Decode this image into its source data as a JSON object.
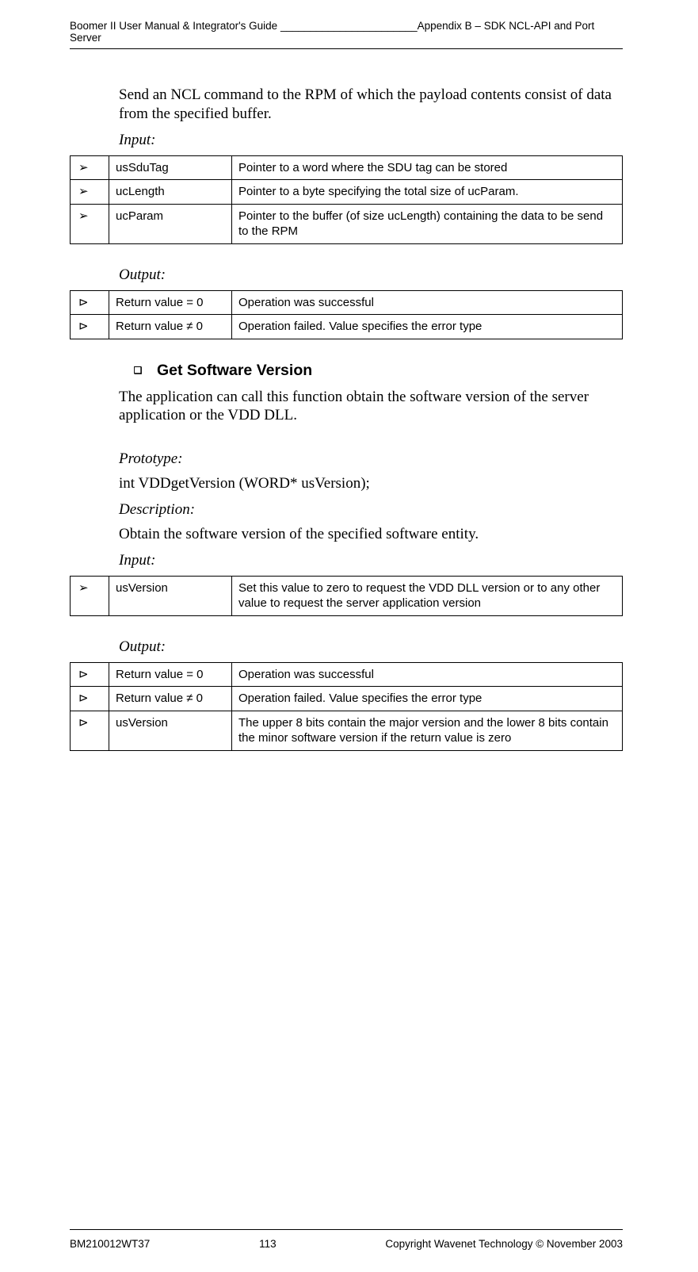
{
  "header": {
    "left": "Boomer II User Manual & Integrator's Guide _______________________Appendix B – SDK NCL-API and Port Server"
  },
  "intro": {
    "text": "Send an NCL command to the RPM of which the payload contents consist of data from the specified buffer."
  },
  "labels": {
    "input": "Input:",
    "output": "Output:",
    "prototype": "Prototype:",
    "description": "Description:"
  },
  "table1": {
    "rows": [
      {
        "arrow": "➢",
        "name": "usSduTag",
        "desc": "Pointer to a word where the SDU tag can be stored"
      },
      {
        "arrow": "➢",
        "name": "ucLength",
        "desc": "Pointer to a byte specifying the total size of ucParam."
      },
      {
        "arrow": "➢",
        "name": "ucParam",
        "desc": "Pointer to the buffer (of size ucLength) containing the data to be send to the RPM"
      }
    ]
  },
  "table2": {
    "rows": [
      {
        "arrow": "⊳",
        "name": "Return value = 0",
        "desc": "Operation was successful"
      },
      {
        "arrow": "⊳",
        "name": "Return value  ≠ 0",
        "desc": "Operation failed. Value specifies the error type"
      }
    ]
  },
  "section": {
    "bullet": "❑",
    "title": "Get Software Version",
    "para": "The application can call this function obtain the software version of the server application or the VDD DLL.",
    "prototype": "int VDDgetVersion (WORD* usVersion);",
    "description": "Obtain the software version of the specified software entity."
  },
  "table3": {
    "rows": [
      {
        "arrow": "➢",
        "name": "usVersion",
        "desc": "Set this value to zero to request the VDD DLL version or to any other value to request the server application version"
      }
    ]
  },
  "table4": {
    "rows": [
      {
        "arrow": "⊳",
        "name": "Return value = 0",
        "desc": "Operation was successful"
      },
      {
        "arrow": "⊳",
        "name": "Return value  ≠ 0",
        "desc": "Operation failed. Value specifies the error type"
      },
      {
        "arrow": "⊳",
        "name": "usVersion",
        "desc": "The upper 8 bits contain the major version and the lower 8 bits contain the minor software version if the return value is zero"
      }
    ]
  },
  "footer": {
    "left": "BM210012WT37",
    "center": "113",
    "right": "Copyright Wavenet Technology © November 2003"
  }
}
